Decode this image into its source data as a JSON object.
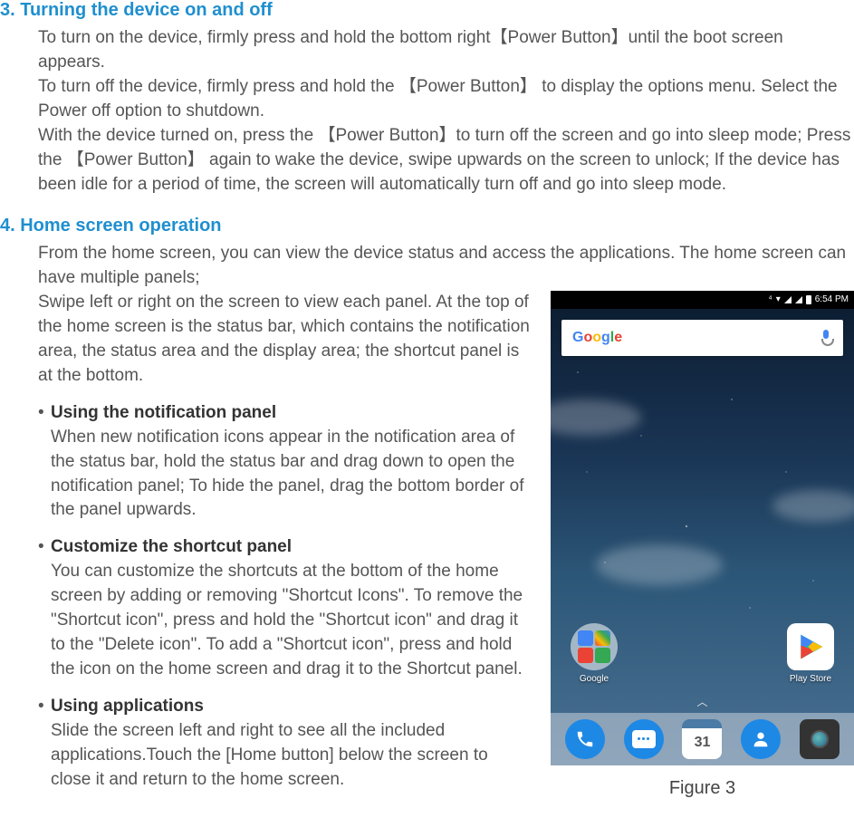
{
  "sections": {
    "s3": {
      "heading": "3. Turning the device on and off",
      "body": "To turn on the device, firmly press and hold the bottom right【Power Button】until the boot screen appears.\nTo turn off the device, firmly press and hold the 【Power Button】 to display the options menu. Select the Power off option to shutdown.\nWith the device turned on, press the 【Power Button】to turn off the screen and go into sleep mode; Press the 【Power Button】 again to wake the device, swipe upwards on the screen to unlock; If the device has been idle for a period of time, the screen will automatically turn off and go into sleep mode."
    },
    "s4": {
      "heading": "4. Home screen operation",
      "introFull": "From the home screen, you can view the device status and access the applications. The home screen can have multiple panels;",
      "introLeft": "Swipe left or right on the screen to view each panel. At the top of the home screen is the status bar, which contains the notification area, the status area and the display area; the shortcut panel is at the bottom.",
      "items": [
        {
          "title": "Using the notification panel",
          "body": "When new notification icons appear in the notification area of the status bar, hold the status bar and drag down to open the notification panel; To hide the panel, drag the bottom border of the panel upwards."
        },
        {
          "title": "Customize the shortcut panel",
          "body": "You can customize the shortcuts at the bottom of the home screen by adding or removing \"Shortcut Icons\". To remove the \"Shortcut icon\", press and hold the \"Shortcut icon\" and drag it to the \"Delete icon\". To add a \"Shortcut icon\", press and hold the icon on the home screen and drag it to the Shortcut panel."
        },
        {
          "title": "Using applications",
          "body": "Slide the screen left and right to see all the included applications.Touch the [Home button] below the screen to close it and return to the home screen."
        }
      ]
    }
  },
  "figure": {
    "caption": "Figure 3",
    "statusTime": "6:54 PM",
    "searchLogo": "Google",
    "folders": [
      {
        "label": "Google"
      },
      {
        "label": "Play Store"
      }
    ],
    "calendarDay": "31"
  }
}
